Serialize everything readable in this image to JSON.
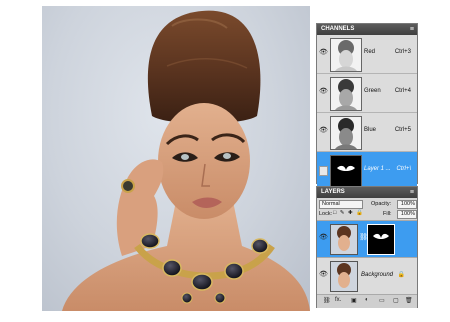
{
  "channels": {
    "title": "CHANNELS",
    "items": [
      {
        "name": "Red",
        "shortcut": "Ctrl+3"
      },
      {
        "name": "Green",
        "shortcut": "Ctrl+4"
      },
      {
        "name": "Blue",
        "shortcut": "Ctrl+5"
      },
      {
        "name": "Layer 1 ...",
        "shortcut": "Ctrl+\\"
      }
    ]
  },
  "layers": {
    "title": "LAYERS",
    "blend_mode": "Normal",
    "opacity_label": "Opacity:",
    "opacity_value": "100%",
    "lock_label": "Lock:",
    "fill_label": "Fill:",
    "fill_value": "100%",
    "items": [
      {
        "name": ""
      },
      {
        "name": "Background"
      }
    ],
    "footer_icons": "fx."
  },
  "colors": {
    "selection": "#3d9cf0",
    "panel_bg": "#d6d6d6",
    "header_bg": "#4a4a4a"
  }
}
